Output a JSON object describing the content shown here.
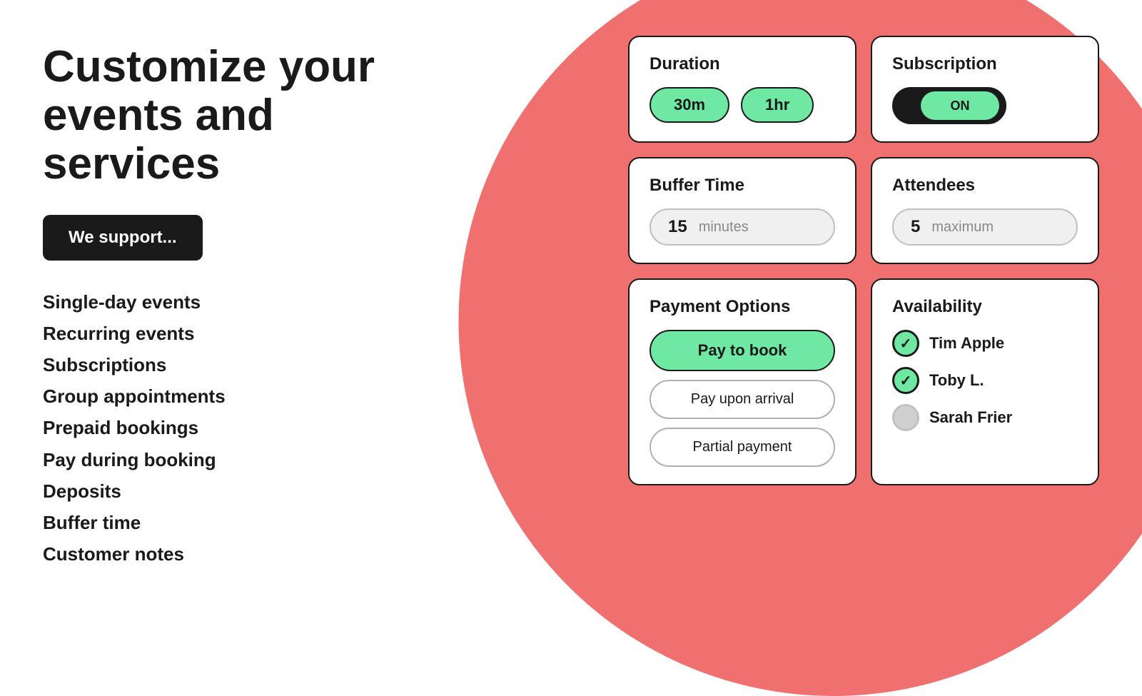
{
  "left": {
    "title_line1": "Customize your",
    "title_line2": "events and services",
    "support_button": "We support...",
    "features": [
      "Single-day events",
      "Recurring events",
      "Subscriptions",
      "Group appointments",
      "Prepaid bookings",
      "Pay during booking",
      "Deposits",
      "Buffer time",
      "Customer notes"
    ]
  },
  "cards": {
    "duration": {
      "title": "Duration",
      "option1": "30m",
      "option2": "1hr"
    },
    "subscription": {
      "title": "Subscription",
      "toggle_label": "ON"
    },
    "buffer_time": {
      "title": "Buffer Time",
      "value": "15",
      "unit": "minutes"
    },
    "attendees": {
      "title": "Attendees",
      "value": "5",
      "unit": "maximum"
    },
    "payment_options": {
      "title": "Payment Options",
      "options": [
        {
          "label": "Pay to book",
          "selected": true
        },
        {
          "label": "Pay upon arrival",
          "selected": false
        },
        {
          "label": "Partial payment",
          "selected": false
        }
      ]
    },
    "availability": {
      "title": "Availability",
      "people": [
        {
          "name": "Tim Apple",
          "checked": true
        },
        {
          "name": "Toby L.",
          "checked": true
        },
        {
          "name": "Sarah Frier",
          "checked": false
        }
      ]
    }
  }
}
